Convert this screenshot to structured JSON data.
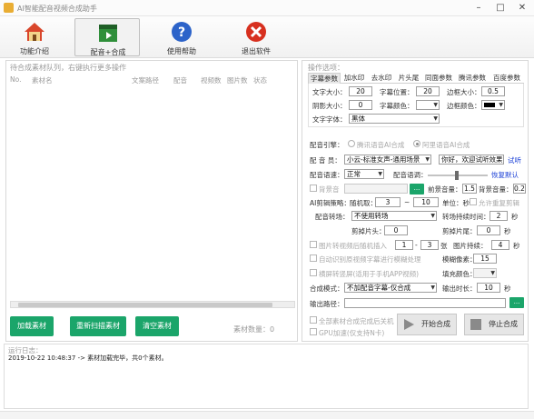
{
  "window": {
    "title": "AI智能配音视频合成助手"
  },
  "toolbar": {
    "home": "功能介绍",
    "compose": "配音+合成",
    "help": "使用帮助",
    "exit": "退出软件"
  },
  "left": {
    "title": "待合成素材队列，右键执行更多操作",
    "columns": [
      "No.",
      "素材名",
      "文案路径",
      "配音",
      "视频数",
      "图片数",
      "状态"
    ],
    "buttons": {
      "load": "加载素材",
      "rescan": "重新扫描素材",
      "clear": "清空素材"
    },
    "count_label": "素材数量：0"
  },
  "right": {
    "title": "操作选项：",
    "tabs": [
      "字幕参数",
      "加水印",
      "去水印",
      "片头尾",
      "同面参数",
      "腾讯参数",
      "百度参数"
    ],
    "subtitle": {
      "font_size_label": "文字大小：",
      "font_size": "20",
      "position_label": "字幕位置：",
      "position": "20",
      "border_size_label": "边框大小：",
      "border_size": "0.5",
      "shadow_label": "阴影大小：",
      "shadow": "0",
      "color_label": "字幕颜色：",
      "border_color_label": "边框颜色：",
      "font_label": "文字字体：",
      "font": "黑体"
    },
    "engine": {
      "label": "配音引擎：",
      "opt1": "腾讯语音AI合成",
      "opt2": "阿里语音AI合成"
    },
    "voice": {
      "label": "配 音 员：",
      "value": "小云-标准女声-通用场景",
      "sample": "你好，欢迎试听效果",
      "try": "试听"
    },
    "speed": {
      "label": "配音语速：",
      "value": "正常",
      "tone_label": "配音语调：",
      "restore": "恢复默认"
    },
    "bgm": {
      "label": "背景音",
      "volume_label": "前景音量：",
      "volume": "1.5",
      "bg_volume_label": "背景音量：",
      "bg_volume": "0.2",
      "browse": "..."
    },
    "ai_clip": {
      "label": "AI剪辑策略：",
      "random_label": "随机取：",
      "from": "3",
      "to": "10",
      "unit": "单位：秒",
      "allow_repeat": "允许重复剪辑"
    },
    "transition": {
      "label": "配音转场：",
      "value": "不使用转场",
      "duration_label": "转场持续时间：",
      "duration": "2",
      "unit": "秒"
    },
    "cut": {
      "head_label": "剪掉片头：",
      "head": "0",
      "tail_label": "剪掉片尾：",
      "tail": "0",
      "unit": "秒"
    },
    "image": {
      "label": "图片转视频后随机插入",
      "from": "1",
      "to": "3",
      "unit": "张",
      "duration_label": "图片持续：",
      "duration": "4",
      "duration_unit": "秒"
    },
    "auto_crop": {
      "label": "自动识别原视频字幕进行模糊处理",
      "blur_label": "模糊像素：",
      "blur": "15"
    },
    "vertical": {
      "label": "横屏转竖屏(适用于手机APP视频)",
      "fill_label": "填充颜色："
    },
    "mode": {
      "label": "合成模式：",
      "value": "不加配音字幕-仅合成",
      "length_label": "输出时长：",
      "length": "10",
      "unit": "秒"
    },
    "output": {
      "label": "输出路径：",
      "browse": "..."
    },
    "finish": {
      "shutdown": "全部素材合成完成后关机",
      "gpu": "GPU加速(仅支持N卡)"
    },
    "actions": {
      "start": "开始合成",
      "stop": "停止合成"
    }
  },
  "log": {
    "title": "运行日志：",
    "lines": [
      "2019-10-22 10:48:37 -> 素材加载完毕，共0个素材。"
    ]
  },
  "statusbar": {
    "text": ""
  }
}
